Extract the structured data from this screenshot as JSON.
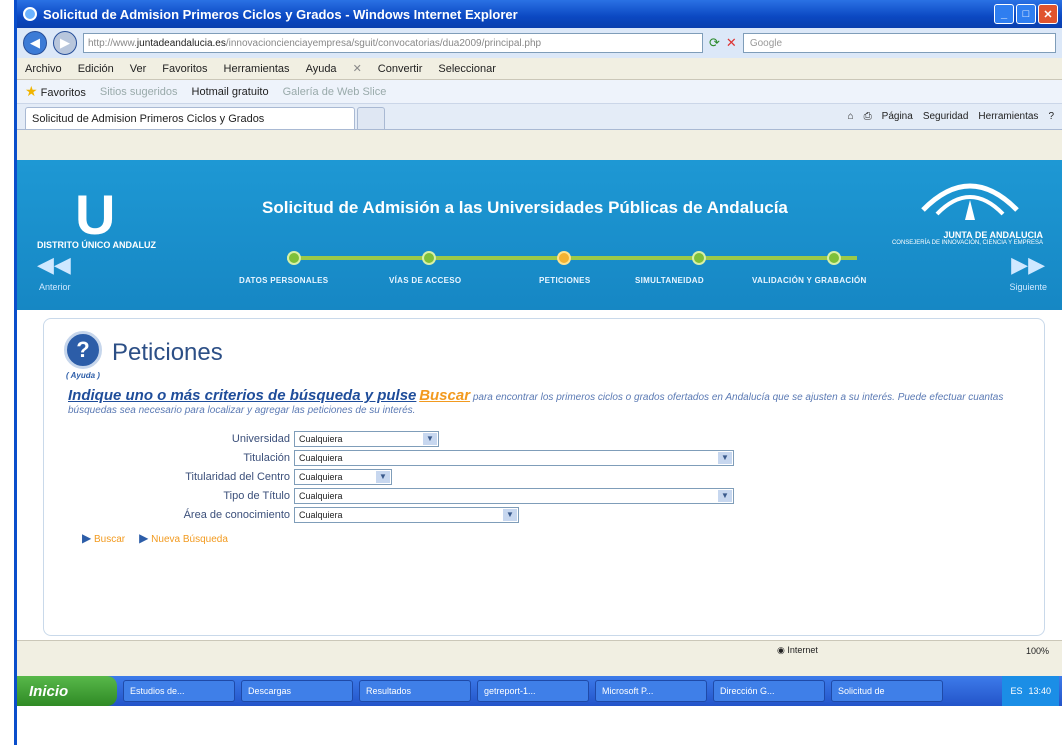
{
  "window": {
    "title": "Solicitud de Admision Primeros Ciclos y Grados - Windows Internet Explorer"
  },
  "address": {
    "url_prefix": "http://www.",
    "url_domain": "juntadeandalucia.es",
    "url_rest": "/innovacioncienciayempresa/sguit/convocatorias/dua2009/principal.php",
    "search_placeholder": "Google"
  },
  "menu": [
    "Archivo",
    "Edición",
    "Ver",
    "Favoritos",
    "Herramientas",
    "Ayuda"
  ],
  "menu_extra": {
    "convert": "Convertir",
    "select": "Seleccionar"
  },
  "favorites": {
    "label": "Favoritos",
    "item1": "Sitios sugeridos",
    "item2": "Hotmail gratuito",
    "item3": "Galería de Web Slice"
  },
  "tab": {
    "title": "Solicitud de Admision Primeros Ciclos y Grados"
  },
  "command": {
    "page": "Página",
    "security": "Seguridad",
    "tools": "Herramientas"
  },
  "banner": {
    "title": "Solicitud de Admisión a las Universidades Públicas de Andalucía",
    "left_logo": "U",
    "left_caption": "DISTRITO ÚNICO ANDALUZ",
    "junta": "JUNTA DE ANDALUCIA",
    "junta_sub": "CONSEJERÍA DE INNOVACIÓN, CIENCIA Y EMPRESA",
    "prev": "Anterior",
    "next": "Siguiente",
    "steps": [
      "DATOS PERSONALES",
      "VÍAS DE ACCESO",
      "PETICIONES",
      "SIMULTANEIDAD",
      "VALIDACIÓN Y GRABACIÓN"
    ]
  },
  "panel": {
    "help_label": "( Ayuda )",
    "title": "Peticiones",
    "instr_big": "Indique uno o más criterios de búsqueda y pulse",
    "instr_buscar": "Buscar",
    "instr_rest": "para encontrar los primeros ciclos o grados ofertados en Andalucía que se ajusten a su interés. Puede efectuar cuantas búsquedas sea necesario para localizar y agregar las peticiones de su interés."
  },
  "form": {
    "universidad": {
      "label": "Universidad",
      "value": "Cualquiera"
    },
    "titulacion": {
      "label": "Titulación",
      "value": "Cualquiera"
    },
    "titularidad": {
      "label": "Titularidad del Centro",
      "value": "Cualquiera"
    },
    "tipo_titulo": {
      "label": "Tipo de Título",
      "value": "Cualquiera"
    },
    "area": {
      "label": "Área de conocimiento",
      "value": "Cualquiera"
    }
  },
  "actions": {
    "buscar": "Buscar",
    "nueva": "Nueva Búsqueda"
  },
  "status": {
    "zone": "Internet",
    "zoom": "100%"
  },
  "taskbar": {
    "start": "Inicio",
    "items": [
      "Estudios de...",
      "Descargas",
      "Resultados",
      "getreport-1...",
      "Microsoft P...",
      "Dirección G...",
      "Solicitud de"
    ],
    "tray": "ES",
    "clock": "13:40"
  },
  "colors": {
    "banner": "#1e98d4",
    "accent": "#f29a1f",
    "title": "#2c4f86"
  }
}
